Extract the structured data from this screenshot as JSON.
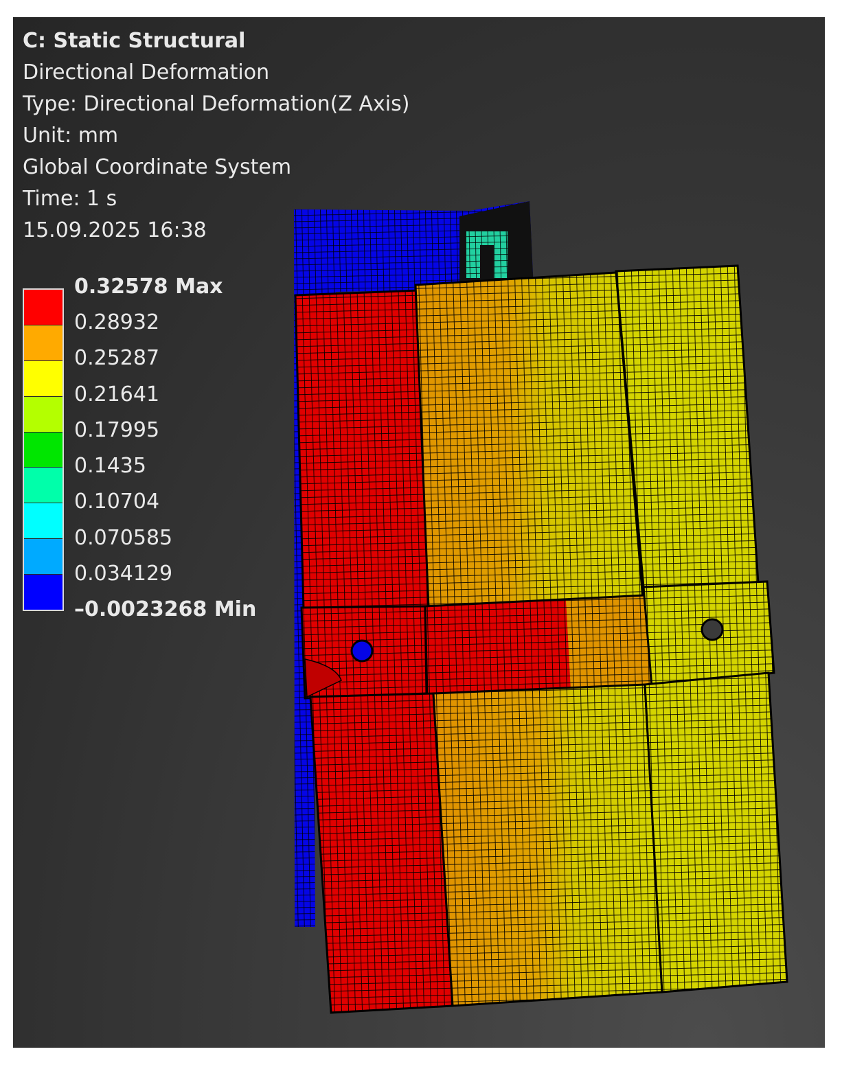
{
  "header": {
    "title": "C: Static Structural",
    "result_name": "Directional Deformation",
    "type": "Type: Directional Deformation(Z Axis)",
    "unit": "Unit: mm",
    "coordinate_system": "Global Coordinate System",
    "time": "Time: 1 s",
    "timestamp": "15.09.2025 16:38"
  },
  "legend": {
    "labels": [
      {
        "text": "0.32578 Max",
        "bold": true
      },
      {
        "text": "0.28932",
        "bold": false
      },
      {
        "text": "0.25287",
        "bold": false
      },
      {
        "text": "0.21641",
        "bold": false
      },
      {
        "text": "0.17995",
        "bold": false
      },
      {
        "text": "0.1435",
        "bold": false
      },
      {
        "text": "0.10704",
        "bold": false
      },
      {
        "text": "0.070585",
        "bold": false
      },
      {
        "text": "0.034129",
        "bold": false
      },
      {
        "text": "–0.0023268 Min",
        "bold": true
      }
    ],
    "colors": [
      "#ff0000",
      "#ffaa00",
      "#ffff00",
      "#b4ff00",
      "#00e600",
      "#00ffaa",
      "#00ffff",
      "#00aaff",
      "#0000ff"
    ]
  },
  "mesh_colors": {
    "back_plate": "#0505e6",
    "bracket": "#22d0a0",
    "red": "#e00000",
    "orange": "#e09a00",
    "yellow_orange": "#e0c800",
    "yellow": "#d8d800"
  }
}
